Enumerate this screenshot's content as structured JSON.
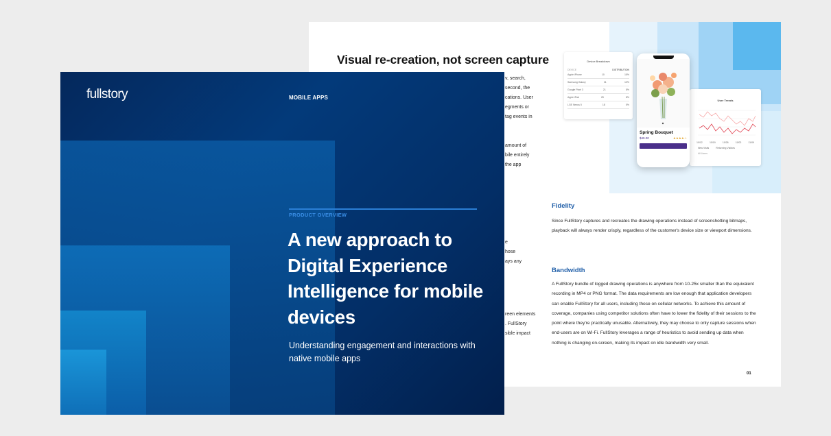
{
  "back_page": {
    "title": "Visual re-creation, not screen capture",
    "fragments": [
      "v, search,",
      "second, the",
      "cations. User",
      "egments or",
      "tag events in",
      "amount of",
      "bile entirely",
      "the app",
      "e",
      "hose",
      "ays any",
      "reen elements",
      ". FullStory",
      "sible impact"
    ],
    "device_card": {
      "title": "Device Breakdown",
      "col_left": "DEVICE",
      "col_right": "DISTRIBUTION",
      "rows": [
        {
          "name": "Apple iPhone",
          "a": "10",
          "b": "15%"
        },
        {
          "name": "Samsung Galaxy",
          "a": "31",
          "b": "10%"
        },
        {
          "name": "Google Pixel 3",
          "a": "21",
          "b": "8%"
        },
        {
          "name": "Apple iPad",
          "a": "25",
          "b": "8%"
        },
        {
          "name": "LGE Nexus 5",
          "a": "18",
          "b": "5%"
        }
      ]
    },
    "trends_card": {
      "title": "User Trends",
      "x_ticks": [
        "10/12",
        "10/19",
        "10/26",
        "11/02",
        "11/09"
      ],
      "legend": [
        "New Visits",
        "Returning Visitors"
      ],
      "footer": "All Users"
    },
    "phone": {
      "product": "Spring Bouquet",
      "price": "$49.00",
      "rating": "★★★★☆"
    },
    "sections": [
      {
        "heading": "Fidelity",
        "body": "Since FullStory captures and recreates the drawing operations instead of screenshotting bitmaps, playback will always render crisply, regardless of the customer's device size or viewport dimensions."
      },
      {
        "heading": "Bandwidth",
        "body": "A FullStory bundle of logged drawing operations is anywhere from 10-25x smaller than the equivalent recording in MP4 or PNG format. The data requirements are low enough that application developers can enable FullStory for all users, including those on cellular networks. To achieve this amount of coverage, companies using competitor solutions often have to lower the fidelity of their sessions to the point where they're practically unusable. Alternatively, they may choose to only capture sessions when end-users are on Wi-Fi. FullStory leverages a range of heuristics to avoid sending up data when nothing is changing on-screen, making its impact on idle bandwidth very small."
      }
    ],
    "page_number": "01"
  },
  "cover": {
    "logo": "fullstory",
    "category": "MOBILE APPS",
    "eyebrow": "PRODUCT OVERVIEW",
    "headline": "A new approach to Digital Experience Intelligence for mobile devices",
    "subtitle": "Understanding engagement and interactions with native mobile apps"
  },
  "colors": {
    "cover_dark": "#021f4c",
    "cover_accent": "#3a8ee6",
    "section_heading": "#1f5ea8",
    "phone_button": "#4a2f8a"
  }
}
